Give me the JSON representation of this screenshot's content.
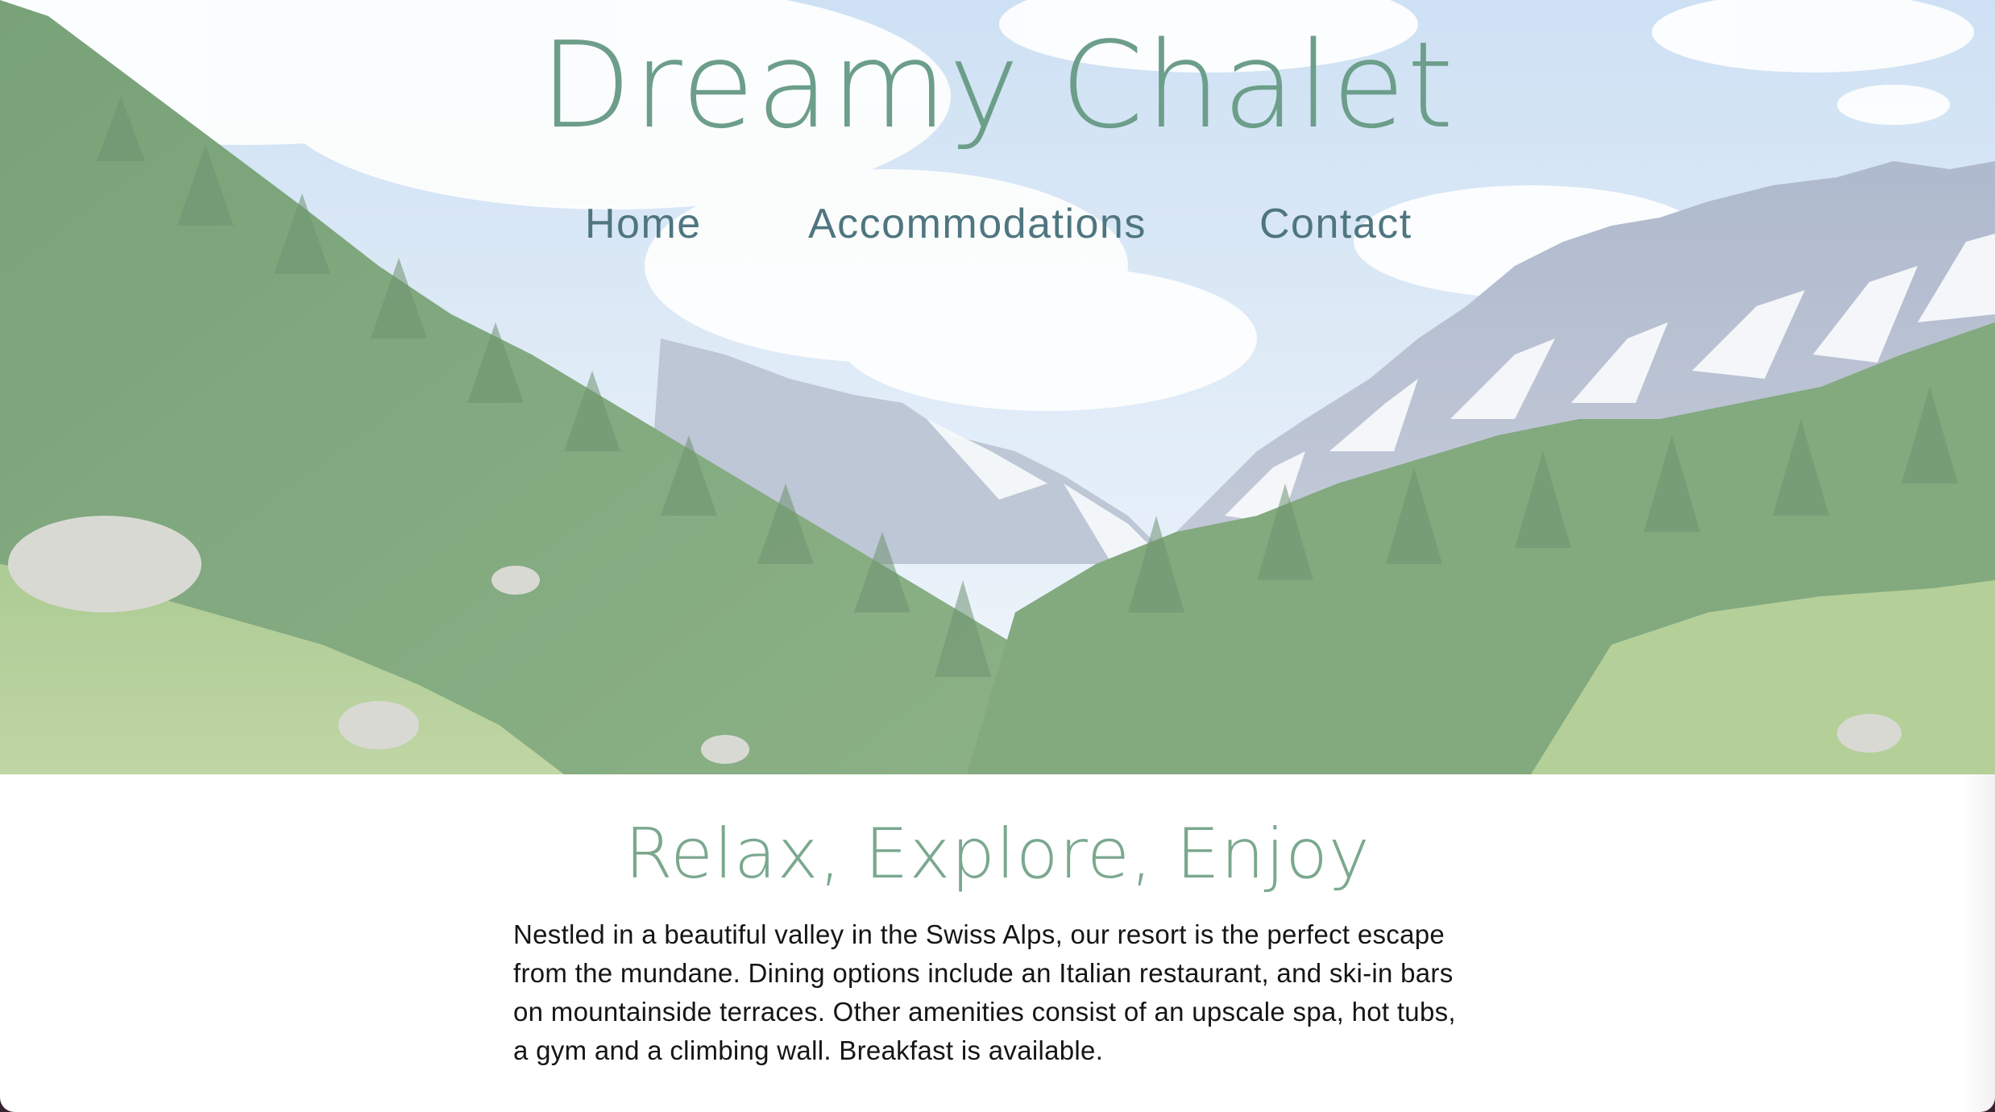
{
  "site": {
    "title": "Dreamy Chalet"
  },
  "nav": {
    "items": [
      {
        "label": "Home"
      },
      {
        "label": "Accommodations"
      },
      {
        "label": "Contact"
      }
    ]
  },
  "hero": {
    "image": "alpine-valley-photo"
  },
  "content": {
    "heading": "Relax, Explore, Enjoy",
    "body": "Nestled in a beautiful valley in the Swiss Alps, our resort is the perfect escape from the mundane. Dining options include an Italian restaurant, and ski-in bars on mountainside terraces. Other amenities consist of an upscale spa, hot tubs, a gym and a climbing wall. Breakfast is available."
  },
  "colors": {
    "brand": "#6c9e8a",
    "nav": "#4f7680",
    "heading": "#7aa88e",
    "text": "#151515"
  }
}
